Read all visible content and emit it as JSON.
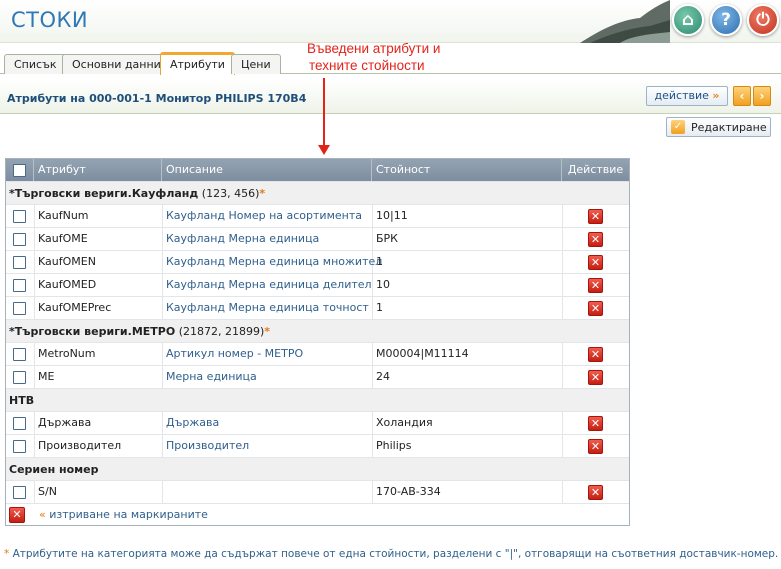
{
  "app": {
    "title": "СТОКИ"
  },
  "tabs": [
    {
      "label": "Списък"
    },
    {
      "label": "Основни данни"
    },
    {
      "label": "Атрибути"
    },
    {
      "label": "Цени"
    }
  ],
  "annotation": {
    "line1": "Въведени атрибути и",
    "line2": "техните стойности"
  },
  "section": {
    "title": "Атрибути на 000-001-1 Монитор PHILIPS 170B4",
    "action_label": "действие",
    "action_chevron": "»",
    "prev": "‹",
    "next": "›",
    "edit_label": "Редактиране"
  },
  "table": {
    "headers": {
      "attribute": "Атрибут",
      "description": "Описание",
      "value": "Стойност",
      "action": "Действие"
    },
    "groups": [
      {
        "name": "*Търговски вериги.Кауфланд",
        "ids": " (123, 456)",
        "star": "*",
        "rows": [
          {
            "attr": "KaufNum",
            "desc": "Кауфланд Номер на асортимента",
            "value": "10|11"
          },
          {
            "attr": "KaufOME",
            "desc": "Кауфланд Мерна единица",
            "value": "БРК"
          },
          {
            "attr": "KaufOMEN",
            "desc": "Кауфланд Мерна единица множител",
            "value": "1"
          },
          {
            "attr": "KaufOMED",
            "desc": "Кауфланд Мерна единица делител",
            "value": "10"
          },
          {
            "attr": "KaufOMEPrec",
            "desc": "Кауфланд Мерна единица точност",
            "value": "1"
          }
        ]
      },
      {
        "name": "*Търговски вериги.МЕТРО",
        "ids": " (21872, 21899)",
        "star": "*",
        "rows": [
          {
            "attr": "MetroNum",
            "desc": "Артикул номер - МЕТРО",
            "value": "M00004|M11114"
          },
          {
            "attr": "ME",
            "desc": "Мерна единица",
            "value": "24"
          }
        ]
      },
      {
        "name": "НТВ",
        "ids": "",
        "star": "",
        "rows": [
          {
            "attr": "Държава",
            "desc": "Държава",
            "value": "Холандия"
          },
          {
            "attr": "Производител",
            "desc": "Производител",
            "value": "Philips"
          }
        ]
      },
      {
        "name": "Сериен номер",
        "ids": "",
        "star": "",
        "rows": [
          {
            "attr": "S/N",
            "desc": "",
            "value": "170-AB-334"
          }
        ]
      }
    ],
    "delete_icon": "✕",
    "footer": {
      "chevron": "«",
      "link": " изтриване на маркираните"
    }
  },
  "footnote": {
    "star": "*",
    "text": " Атрибутите на категорията може да съдържат повече от една стойности, разделени с \"|\", отговарящи на съответния доставчик-номер."
  }
}
